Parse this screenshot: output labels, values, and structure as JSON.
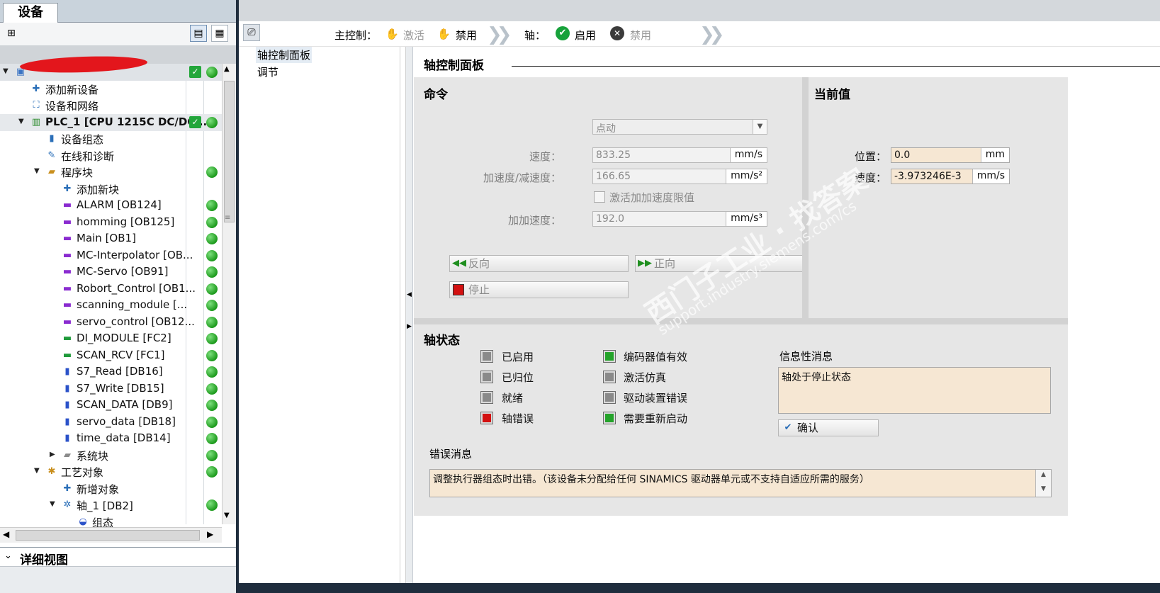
{
  "left": {
    "tab": "设备",
    "tree": [
      {
        "label": "",
        "indent": 0,
        "tri": "▼",
        "icon": "plc",
        "check": true,
        "dot": true,
        "redacted": true
      },
      {
        "label": "添加新设备",
        "indent": 1,
        "icon": "add-device",
        "check": false,
        "dot": false
      },
      {
        "label": "设备和网络",
        "indent": 1,
        "icon": "network",
        "check": false,
        "dot": false
      },
      {
        "label": "PLC_1 [CPU 1215C DC/DC/...",
        "indent": 1,
        "tri": "▼",
        "icon": "cpu",
        "bold": true,
        "check": true,
        "dot": true
      },
      {
        "label": "设备组态",
        "indent": 2,
        "icon": "config",
        "dot": false
      },
      {
        "label": "在线和诊断",
        "indent": 2,
        "icon": "diag",
        "dot": false
      },
      {
        "label": "程序块",
        "indent": 2,
        "tri": "▼",
        "icon": "folder",
        "dot": true
      },
      {
        "label": "添加新块",
        "indent": 3,
        "icon": "add-block",
        "dot": false
      },
      {
        "label": "ALARM [OB124]",
        "indent": 3,
        "icon": "ob",
        "dot": true
      },
      {
        "label": "homming [OB125]",
        "indent": 3,
        "icon": "ob",
        "dot": true
      },
      {
        "label": "Main [OB1]",
        "indent": 3,
        "icon": "ob",
        "dot": true
      },
      {
        "label": "MC-Interpolator [OB...",
        "indent": 3,
        "icon": "ob-lock",
        "dot": true
      },
      {
        "label": "MC-Servo [OB91]",
        "indent": 3,
        "icon": "ob-lock",
        "dot": true
      },
      {
        "label": "Robort_Control [OB1...",
        "indent": 3,
        "icon": "ob",
        "dot": true
      },
      {
        "label": "scanning_module [...",
        "indent": 3,
        "icon": "ob",
        "dot": true
      },
      {
        "label": "servo_control [OB12...",
        "indent": 3,
        "icon": "ob",
        "dot": true
      },
      {
        "label": "DI_MODULE [FC2]",
        "indent": 3,
        "icon": "fc",
        "dot": true
      },
      {
        "label": "SCAN_RCV [FC1]",
        "indent": 3,
        "icon": "fc",
        "dot": true
      },
      {
        "label": "S7_Read [DB16]",
        "indent": 3,
        "icon": "db",
        "dot": true
      },
      {
        "label": "S7_Write [DB15]",
        "indent": 3,
        "icon": "db",
        "dot": true
      },
      {
        "label": "SCAN_DATA [DB9]",
        "indent": 3,
        "icon": "db",
        "dot": true
      },
      {
        "label": "servo_data [DB18]",
        "indent": 3,
        "icon": "db",
        "dot": true
      },
      {
        "label": "time_data [DB14]",
        "indent": 3,
        "icon": "db",
        "dot": true
      },
      {
        "label": "系统块",
        "indent": 3,
        "tri": "▶",
        "icon": "folder-grey",
        "dot": true
      },
      {
        "label": "工艺对象",
        "indent": 2,
        "tri": "▼",
        "icon": "tech",
        "dot": true
      },
      {
        "label": "新增对象",
        "indent": 3,
        "icon": "add-obj",
        "dot": false
      },
      {
        "label": "轴_1 [DB2]",
        "indent": 3,
        "tri": "▼",
        "icon": "axis",
        "dot": true
      },
      {
        "label": "组态",
        "indent": 4,
        "icon": "cfg",
        "dot": false
      }
    ],
    "detail_title": "详细视图"
  },
  "toolbar": {
    "master_label": "主控制：",
    "master_activate": "激活",
    "master_disable": "禁用",
    "axis_label": "轴：",
    "axis_enable": "启用",
    "axis_disable": "禁用"
  },
  "nav": {
    "items": [
      "轴控制面板",
      "调节"
    ]
  },
  "panel": {
    "title": "轴控制面板",
    "command": {
      "heading": "命令",
      "mode": "点动",
      "speed_label": "速度：",
      "speed_value": "833.25",
      "speed_unit": "mm/s",
      "accel_label": "加速度/减速度：",
      "accel_value": "166.65",
      "accel_unit": "mm/s²",
      "jerk_check_label": "激活加加速度限值",
      "jerk_label": "加加速度：",
      "jerk_value": "192.0",
      "jerk_unit": "mm/s³",
      "btn_backward": "反向",
      "btn_forward": "正向",
      "btn_stop": "停止"
    },
    "current": {
      "heading": "当前值",
      "pos_label": "位置：",
      "pos_value": "0.0",
      "pos_unit": "mm",
      "vel_label": "速度：",
      "vel_value": "-3.973246E-3",
      "vel_unit": "mm/s"
    },
    "status": {
      "heading": "轴状态",
      "leds_left": [
        {
          "label": "已启用",
          "state": "grey"
        },
        {
          "label": "已归位",
          "state": "grey"
        },
        {
          "label": "就绪",
          "state": "grey"
        },
        {
          "label": "轴错误",
          "state": "red"
        }
      ],
      "leds_right": [
        {
          "label": "编码器值有效",
          "state": "green"
        },
        {
          "label": "激活仿真",
          "state": "grey"
        },
        {
          "label": "驱动装置错误",
          "state": "grey"
        },
        {
          "label": "需要重新启动",
          "state": "green"
        }
      ],
      "info_heading": "信息性消息",
      "info_text": "轴处于停止状态",
      "ack_button": "确认",
      "error_heading": "错误消息",
      "error_text": "调整执行器组态时出错。（该设备未分配给任何 SINAMICS 驱动器单元或不支持自适应所需的服务）"
    }
  },
  "watermark": "西门子工业 support.industry.siemens.com/cs",
  "colors": {
    "led_green": "#24a32a",
    "led_red": "#d31111",
    "current_value_bg": "#f6e7d3",
    "panel_bg": "#e6e6e6"
  }
}
